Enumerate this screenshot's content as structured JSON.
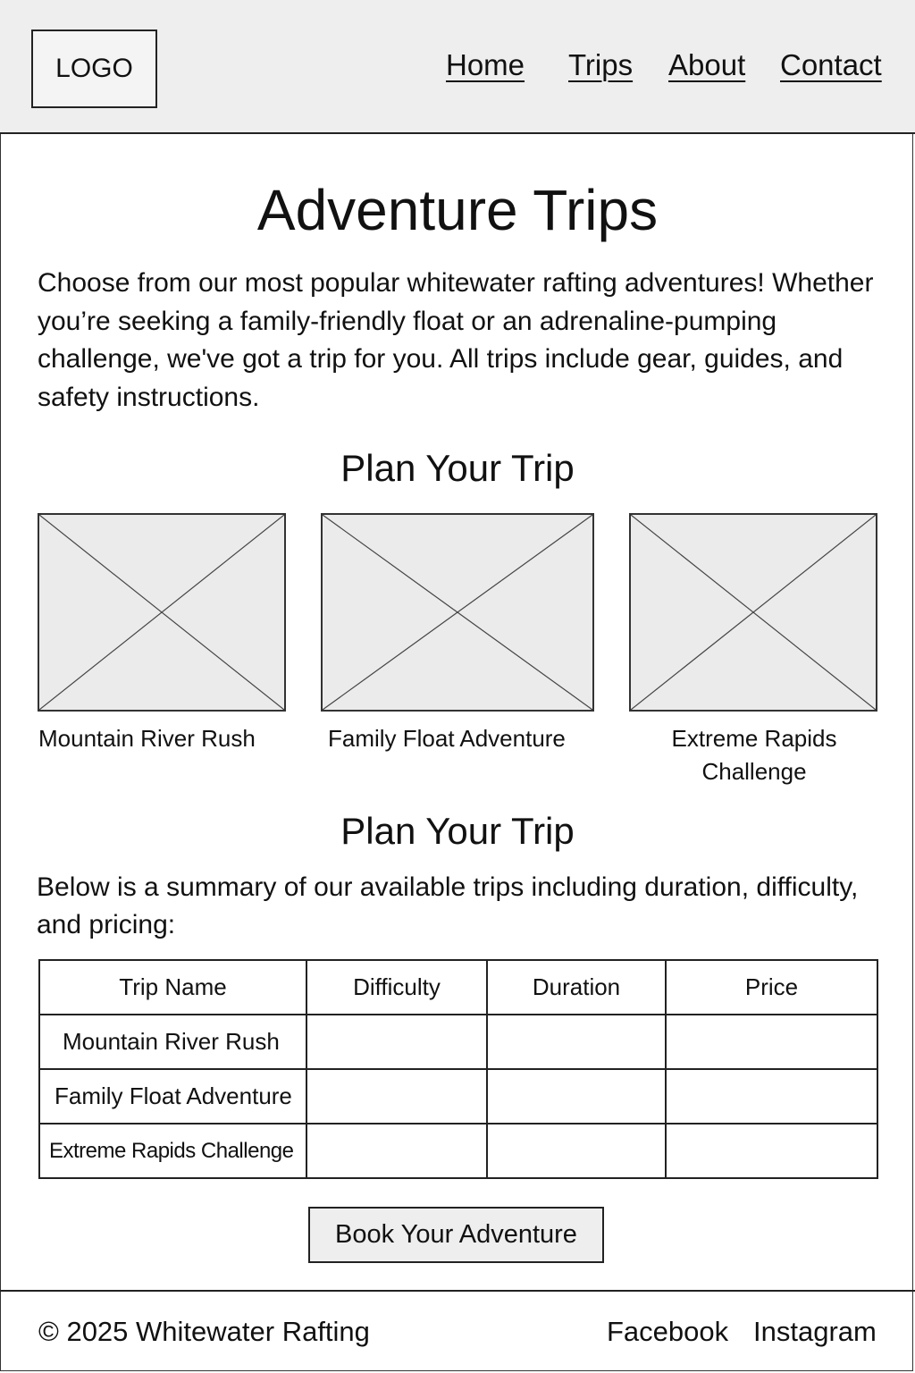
{
  "header": {
    "logo_text": "LOGO",
    "nav": [
      "Home",
      "Trips",
      "About",
      "Contact"
    ]
  },
  "main": {
    "title": "Adventure Trips",
    "intro": "Choose from our most popular whitewater rafting adventures! Whether you’re seeking a family-friendly float or an adrenaline-pumping challenge, we've got a trip for you. All trips include gear, guides, and safety instructions.",
    "cards_heading": "Plan Your Trip",
    "cards": [
      {
        "label": "Mountain River Rush"
      },
      {
        "label": "Family Float Adventure"
      },
      {
        "label": "Extreme Rapids Challenge"
      }
    ],
    "table_heading": "Plan Your Trip",
    "table_intro": "Below is a summary of our available trips including duration, difficulty, and pricing:",
    "table": {
      "headers": [
        "Trip Name",
        "Difficulty",
        "Duration",
        "Price"
      ],
      "rows": [
        [
          "Mountain River Rush",
          "",
          "",
          ""
        ],
        [
          "Family Float Adventure",
          "",
          "",
          ""
        ],
        [
          "Extreme Rapids Challenge",
          "",
          "",
          ""
        ]
      ]
    },
    "book_label": "Book Your Adventure"
  },
  "footer": {
    "copyright": "© 2025 Whitewater Rafting",
    "links": [
      "Facebook",
      "Instagram"
    ]
  },
  "icons": {
    "image_placeholder": "image-placeholder-icon"
  }
}
